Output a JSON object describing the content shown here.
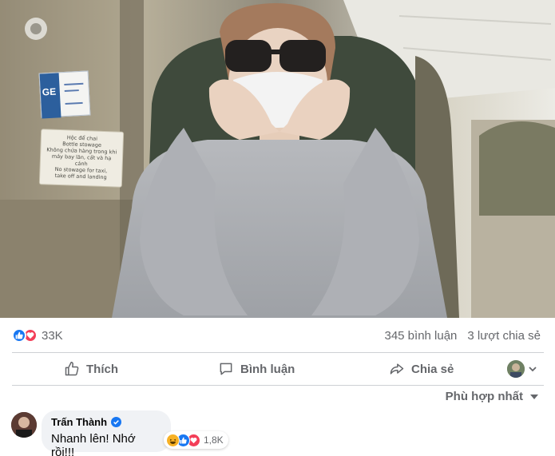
{
  "post": {
    "photo": {
      "tag_lines": [
        "Hộc để chai",
        "Bottle stowage",
        "Không chứa hàng trong khi",
        "máy bay lăn, cất và hạ cánh",
        "No stowage for taxi,",
        "take off and landing"
      ],
      "ticket_text": "GE"
    },
    "stats": {
      "reaction_icons": [
        "like-icon",
        "love-icon"
      ],
      "reaction_count": "33K",
      "comments_count": "345 bình luận",
      "shares_count": "3 lượt chia sẻ"
    },
    "actions": {
      "like_label": "Thích",
      "comment_label": "Bình luận",
      "share_label": "Chia sẻ"
    },
    "sort": {
      "label": "Phù hợp nhất"
    }
  },
  "comments": [
    {
      "author": "Trấn Thành",
      "verified": true,
      "text": "Nhanh lên! Nhớ rồi!!!",
      "reaction_icons": [
        "haha-icon",
        "like-icon",
        "love-icon"
      ],
      "reaction_count": "1,8K"
    }
  ],
  "colors": {
    "facebook_blue": "#1877f2",
    "love_red": "#f33e58",
    "haha_yellow": "#f7b125",
    "secondary_text": "#65676b",
    "bubble_bg": "#f0f2f5"
  }
}
